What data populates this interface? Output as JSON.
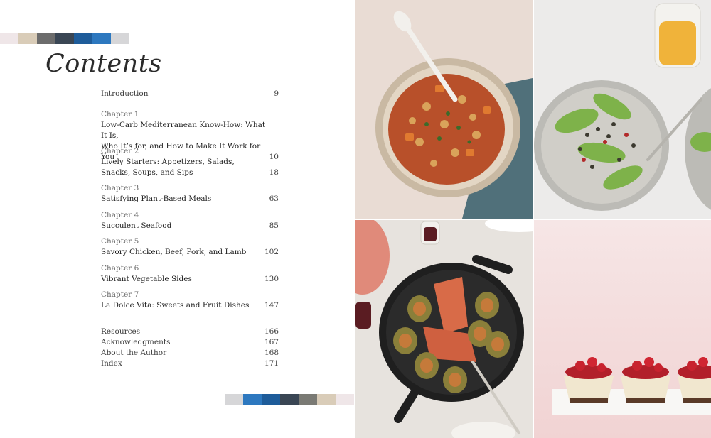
{
  "book": {
    "title": "Contents"
  },
  "swatches_top": [
    "#efe6e8",
    "#d9ccb8",
    "#6c6c6c",
    "#3a4654",
    "#1e5c9a",
    "#2d78bf",
    "#d6d6d8"
  ],
  "swatches_bottom": [
    "#d6d6d8",
    "#2d78bf",
    "#1e5c9a",
    "#3a4654",
    "#7a7a74",
    "#d9ccb8",
    "#efe6e8"
  ],
  "toc": {
    "intro": {
      "label": "Introduction",
      "page": "9"
    },
    "chapters": [
      {
        "kicker": "Chapter 1",
        "title_line1": "Low-Carb Mediterranean Know-How: What It Is,",
        "title_line2": "Who It’s for, and How to Make It Work for You",
        "page": "10"
      },
      {
        "kicker": "Chapter 2",
        "title_line1": "Lively Starters: Appetizers, Salads,",
        "title_line2": "Snacks, Soups, and Sips",
        "page": "18"
      },
      {
        "kicker": "Chapter 3",
        "title_line1": "Satisfying Plant-Based Meals",
        "title_line2": "",
        "page": "63"
      },
      {
        "kicker": "Chapter 4",
        "title_line1": "Succulent Seafood",
        "title_line2": "",
        "page": "85"
      },
      {
        "kicker": "Chapter 5",
        "title_line1": "Savory Chicken, Beef, Pork, and Lamb",
        "title_line2": "",
        "page": "102"
      },
      {
        "kicker": "Chapter 6",
        "title_line1": "Vibrant Vegetable Sides",
        "title_line2": "",
        "page": "130"
      },
      {
        "kicker": "Chapter 7",
        "title_line1": "La Dolce Vita: Sweets and Fruit Dishes",
        "title_line2": "",
        "page": "147"
      }
    ],
    "backmatter": [
      {
        "label": "Resources",
        "page": "166"
      },
      {
        "label": "Acknowledgments",
        "page": "167"
      },
      {
        "label": "About the Author",
        "page": "168"
      },
      {
        "label": "Index",
        "page": "171"
      }
    ]
  },
  "photos": [
    {
      "name": "chickpea-stew-photo",
      "bg": "#e9dcd4"
    },
    {
      "name": "lentil-salad-photo",
      "bg": "#ecebea"
    },
    {
      "name": "salmon-figs-skillet-photo",
      "bg": "#e7e3de"
    },
    {
      "name": "mini-cheesecakes-photo",
      "bg": "#f4dcdc"
    }
  ]
}
